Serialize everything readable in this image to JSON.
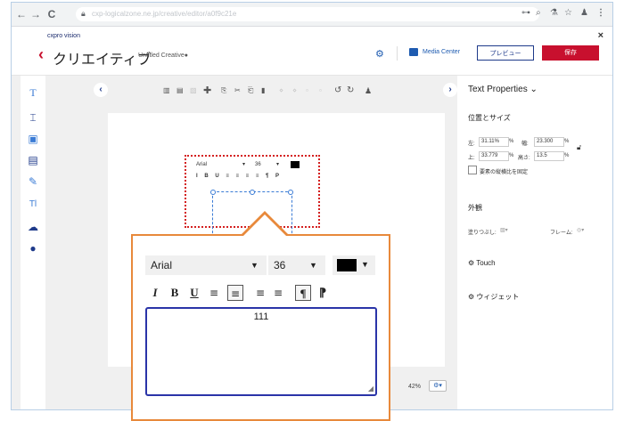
{
  "browser": {
    "url": "cxp-logicalzone.ne.jp/creative/editor/a0f9c21e",
    "back": "←",
    "forward": "→",
    "reload": "C",
    "extensions": [
      "⊶",
      "⌕",
      "⚗",
      "☆",
      "♟",
      "⋮"
    ]
  },
  "header": {
    "logo": "cxpro vision",
    "back_chevron": "‹",
    "title": "クリエイティブ",
    "creative_name": "Untitled Creative●",
    "media_center": "Media Center",
    "preview": "プレビュー",
    "save": "保存",
    "close": "×"
  },
  "left_tools": [
    "T",
    "⌶",
    "▣",
    "▤",
    "✎",
    "Tl",
    "☁",
    "●"
  ],
  "toolbar_icons": [
    "▥",
    "▤",
    "▧",
    "✚",
    "⎘",
    "✂",
    "⎗",
    "▮",
    "⋄",
    "⋄",
    "▫",
    "▫",
    "↺",
    "↻",
    "♟"
  ],
  "canvas": {
    "zoom": "42%",
    "zoom_button": "⚙▾"
  },
  "mini_editor": {
    "font": "Arial",
    "size": "36",
    "fmt": "I B U ≡ ≡ ≡ ≡ ¶ P"
  },
  "properties": {
    "title": "Text Properties ⌄",
    "position_section": "位置とサイズ",
    "left_label": "左:",
    "left_value": "31.11%",
    "width_label": "幅:",
    "width_value": "23.300",
    "top_label": "上:",
    "top_value": "33.779",
    "height_label": "高さ:",
    "height_value": "13.5",
    "pct": "%",
    "aspect_checkbox_label": "要素の縦横比を固定",
    "appearance_section": "外観",
    "fill_label": "塗りつぶし:",
    "frame_label": "フレーム:",
    "touch_section": "Touch",
    "widget_section": "ウィジェット"
  },
  "callout": {
    "font": "Arial",
    "size": "36",
    "color": "#000000",
    "format": {
      "italic": "I",
      "bold": "B",
      "underline": "U",
      "align_left": "≡",
      "align_center": "≡",
      "align_right": "≡",
      "justify": "≡",
      "ltr": "¶",
      "rtl": "⁋"
    },
    "content": "111"
  }
}
